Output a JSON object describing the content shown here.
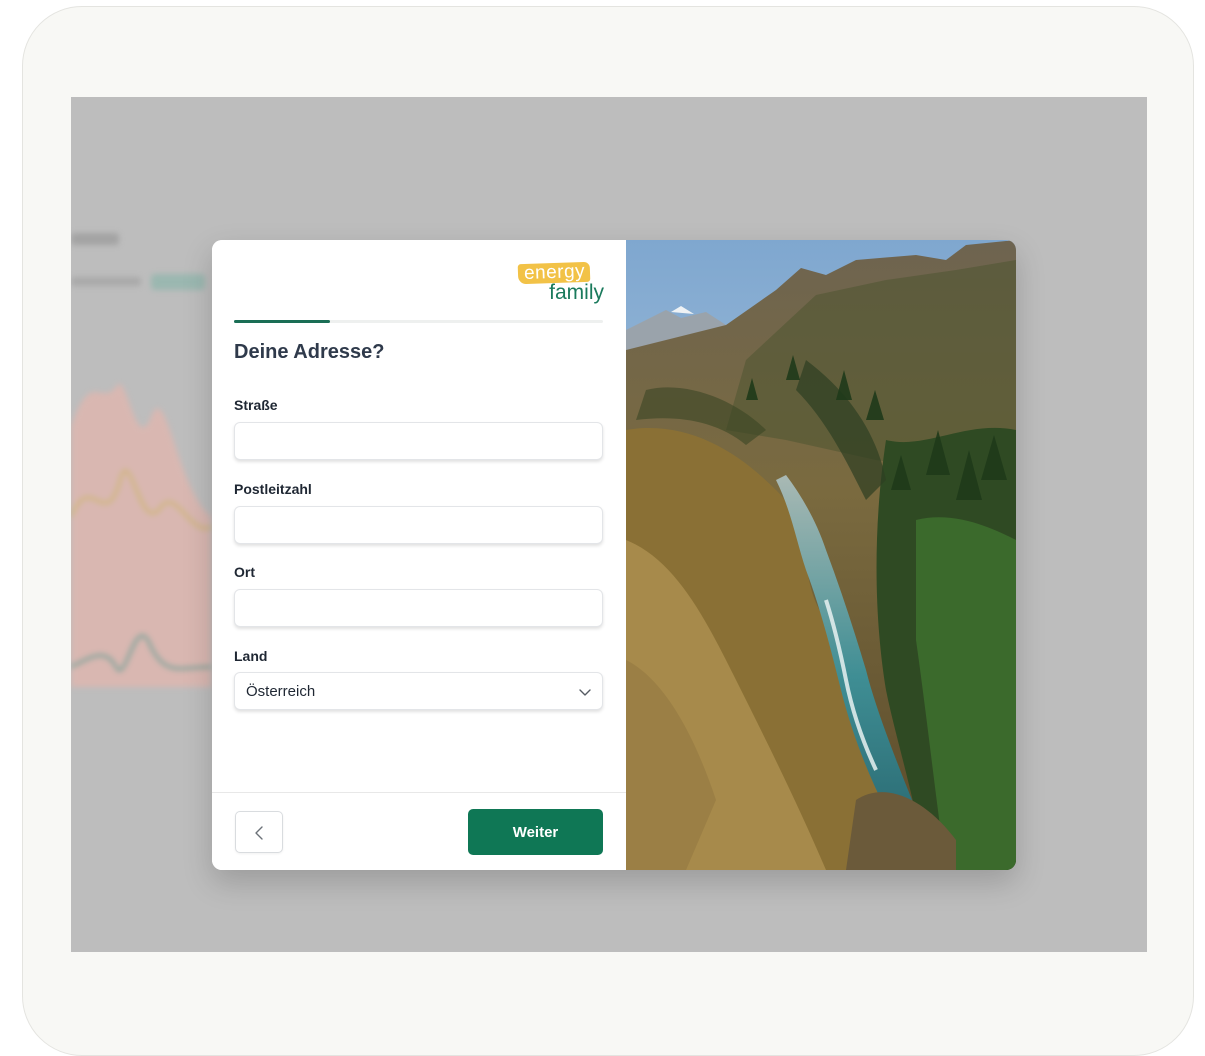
{
  "logo": {
    "line1": "energy",
    "line2": "family"
  },
  "progress": {
    "fraction": 0.26
  },
  "form": {
    "heading": "Deine Adresse?",
    "street": {
      "label": "Straße",
      "value": ""
    },
    "postal_code": {
      "label": "Postleitzahl",
      "value": ""
    },
    "city": {
      "label": "Ort",
      "value": ""
    },
    "country": {
      "label": "Land",
      "selected": "Österreich"
    }
  },
  "footer": {
    "next_label": "Weiter"
  },
  "colors": {
    "primary": "#0f7755",
    "logo_yellow": "#f2c247",
    "logo_green": "#1a7a5c",
    "overlay": "#bdbdbd"
  },
  "icons": {
    "back": "chevron-left-icon",
    "dropdown": "chevron-down-icon"
  }
}
